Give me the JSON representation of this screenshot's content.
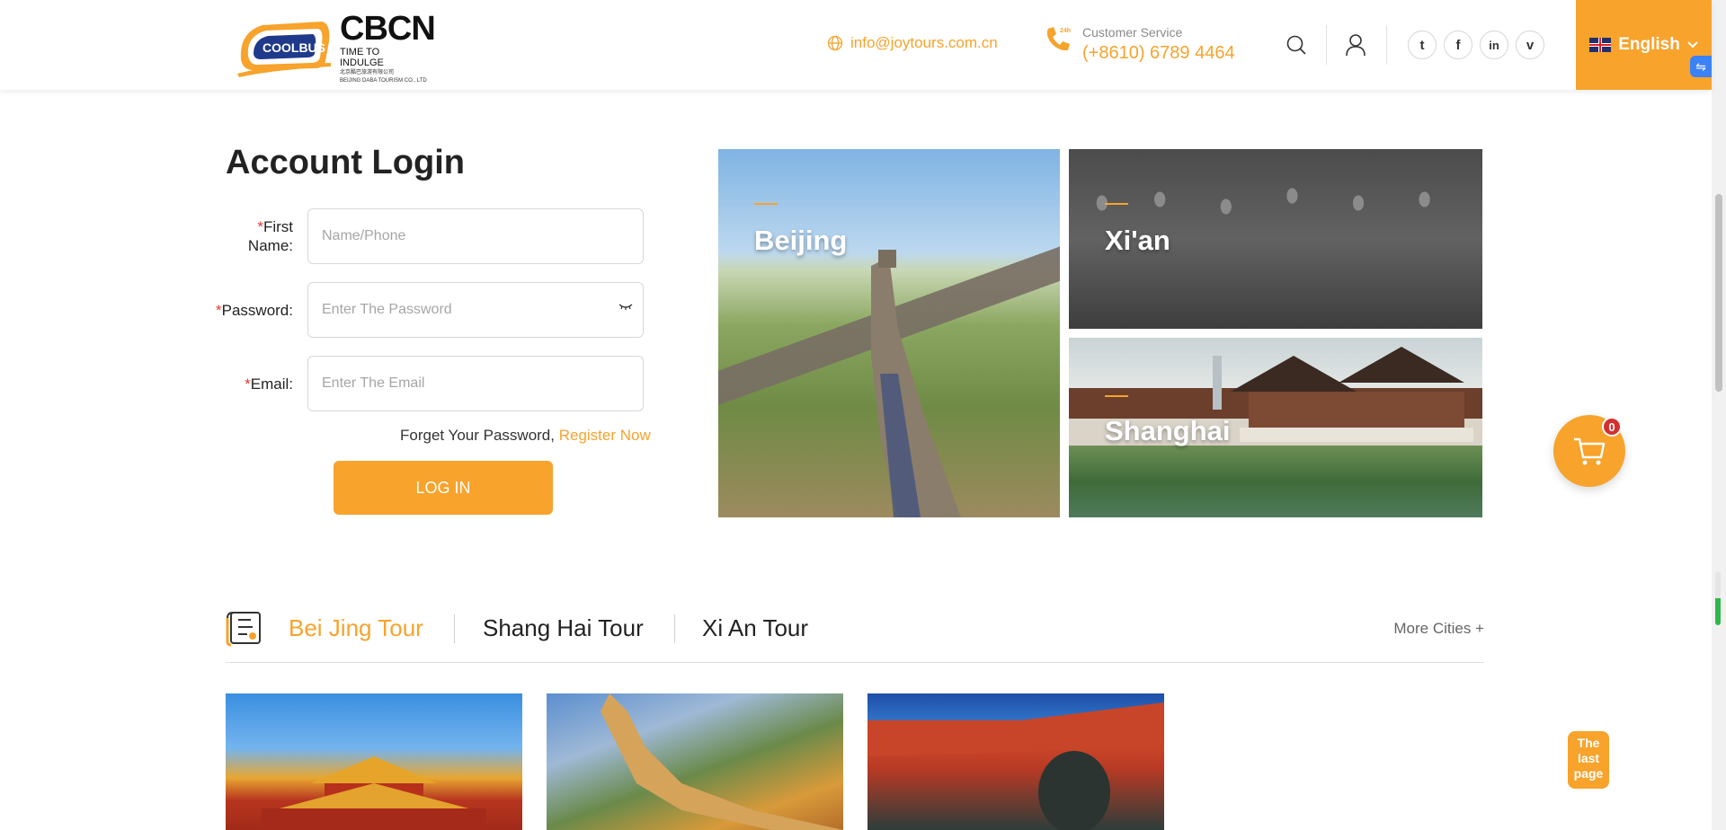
{
  "header": {
    "logo": {
      "brand_mark": "COOLBUS",
      "name": "CBCN",
      "tagline_1": "TIME TO",
      "tagline_2": "INDULGE",
      "small_chinese": "北京酷巴旅游有限公司",
      "small_english": "BEIJING DABA TOURISM CO., LTD"
    },
    "email": "info@joytours.com.cn",
    "customer_service_label": "Customer Service",
    "phone": "(+8610) 6789 4464",
    "phone_badge": "24h",
    "social": {
      "twitter": "t",
      "facebook": "f",
      "linkedin": "in",
      "vimeo": "v"
    },
    "language": "English"
  },
  "login": {
    "title": "Account Login",
    "required_mark": "*",
    "first_name_label": "First Name:",
    "first_name_placeholder": "Name/Phone",
    "password_label": "Password:",
    "password_placeholder": "Enter The Password",
    "email_label": "Email:",
    "email_placeholder": "Enter The Email",
    "forgot_text": "Forget Your Password,",
    "register_text": "Register Now",
    "login_button": "LOG IN"
  },
  "cities": [
    {
      "name": "Beijing"
    },
    {
      "name": "Xi'an"
    },
    {
      "name": "Shanghai"
    }
  ],
  "tour_tabs": {
    "tabs": [
      {
        "label": "Bei Jing Tour"
      },
      {
        "label": "Shang Hai Tour"
      },
      {
        "label": "Xi An Tour"
      }
    ],
    "more": "More Cities +"
  },
  "cart": {
    "count": "0"
  },
  "last_page": {
    "line_1": "The",
    "line_2": "last",
    "line_3": "page"
  },
  "colors": {
    "accent": "#f7a32c",
    "badge": "#d32f2f",
    "required": "#e53935"
  }
}
